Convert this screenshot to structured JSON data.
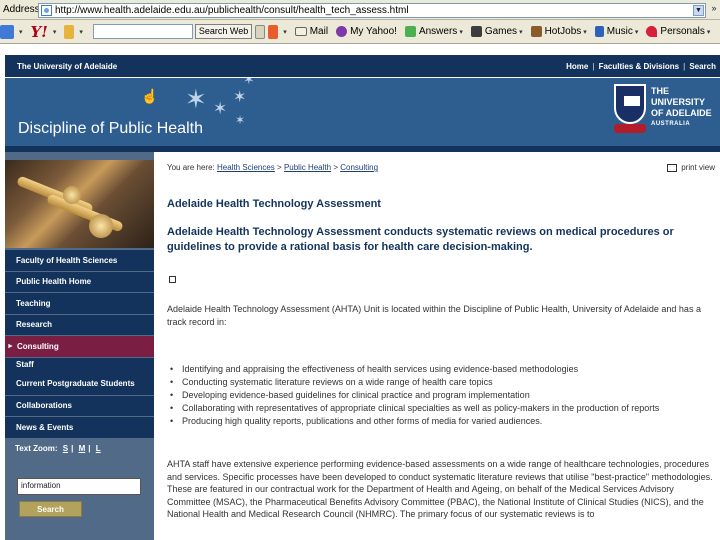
{
  "browser": {
    "address_label": "Address",
    "url": "http://www.health.adelaide.edu.au/publichealth/consult/health_tech_assess.html",
    "toolbar": {
      "search_label": "Search Web",
      "items": [
        "Mail",
        "My Yahoo!",
        "Answers",
        "Games",
        "HotJobs",
        "Music",
        "Personals"
      ]
    }
  },
  "site": {
    "top_nav": {
      "left": "The University of Adelaide",
      "links": [
        "Home",
        "Faculties & Divisions",
        "Search"
      ]
    },
    "banner": {
      "title": "Discipline of Public Health",
      "university_line1": "THE UNIVERSITY",
      "university_line2": "OF ADELAIDE",
      "university_line3": "AUSTRALIA",
      "ribbon_text": "SUB CRUCE LUMEN"
    },
    "sidebar": {
      "nav": [
        "Faculty of Health Sciences",
        "Public Health Home",
        "Teaching",
        "Research",
        "Consulting",
        "Staff",
        "Current Postgraduate Students",
        "Collaborations",
        "News & Events"
      ],
      "active_index": 4,
      "text_zoom_label": "Text Zoom:",
      "text_zoom_options": [
        "S",
        "M",
        "L"
      ],
      "search_value": "information",
      "search_button": "Search"
    },
    "main": {
      "breadcrumb_prefix": "You are here:",
      "breadcrumb": [
        "Health Sciences",
        "Public Health",
        "Consulting"
      ],
      "print_view": "print view",
      "title": "Adelaide Health Technology Assessment",
      "summary": "Adelaide Health Technology Assessment conducts systematic reviews on medical procedures or guidelines to provide a rational basis for health care decision-making.",
      "intro": "Adelaide Health Technology Assessment (AHTA) Unit is located within the Discipline of Public Health, University of Adelaide and has a track record in:",
      "bullets": [
        "Identifying and appraising the effectiveness of health services using evidence-based methodologies",
        "Conducting systematic literature reviews on a wide range of health care topics",
        "Developing evidence-based guidelines for clinical practice and program implementation",
        "Collaborating with representatives of appropriate clinical specialties as well as policy-makers in the production of reports",
        "Producing high quality reports, publications and other forms of media for varied audiences."
      ],
      "staff_paragraph": "AHTA staff have extensive experience performing evidence-based assessments on a wide range of healthcare technologies, procedures and services. Specific processes have been developed to conduct systematic literature reviews that utilise \"best-practice\" methodologies. These are featured in our contractual work for the Department of Health and Ageing, on behalf of the Medical Services Advisory Committee (MSAC), the Pharmaceutical Benefits Advisory Committee (PBAC), the National Institute of Clinical Studies (NICS), and the National Health and Medical Research Council (NHMRC). The primary focus of our systematic reviews is to"
    }
  },
  "colors": {
    "navy": "#13335d",
    "banner_blue": "#2e5e90",
    "active_nav": "#7a1f43",
    "sidebar_bg": "#516a87",
    "search_button": "#b2a25c"
  },
  "icons": [
    "page-icon",
    "yahoo-logo",
    "mail-icon",
    "my-yahoo-icon",
    "answers-icon",
    "games-icon",
    "hotjobs-icon",
    "music-icon",
    "personals-icon",
    "star-icon",
    "crest-icon",
    "print-icon",
    "cursor-icon"
  ]
}
